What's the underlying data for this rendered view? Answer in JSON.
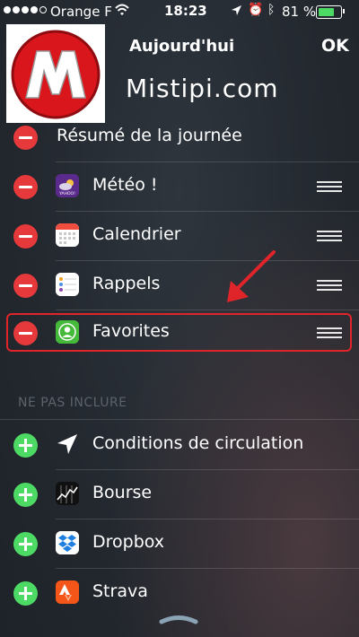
{
  "status_bar": {
    "carrier": "Orange F",
    "time": "18:23",
    "battery_percent": "81 %",
    "battery_level": 0.81,
    "battery_color": "#4cd964"
  },
  "header": {
    "title": "Aujourd'hui",
    "done_label": "OK"
  },
  "watermark": {
    "text": "Mistipi.com",
    "logo_letter": "M"
  },
  "included": {
    "items": [
      {
        "label": "Résumé de la journée",
        "icon": "none"
      },
      {
        "label": "Météo !",
        "icon": "yahoo-weather-icon"
      },
      {
        "label": "Calendrier",
        "icon": "calendar-icon"
      },
      {
        "label": "Rappels",
        "icon": "reminders-icon"
      },
      {
        "label": "Favorites",
        "icon": "favorites-contact-icon",
        "highlighted": true
      }
    ]
  },
  "excluded": {
    "section_title": "NE PAS INCLURE",
    "items": [
      {
        "label": "Conditions de circulation",
        "icon": "location-arrow-icon"
      },
      {
        "label": "Bourse",
        "icon": "stocks-icon"
      },
      {
        "label": "Dropbox",
        "icon": "dropbox-icon"
      },
      {
        "label": "Strava",
        "icon": "strava-icon"
      }
    ]
  },
  "colors": {
    "remove": "#e5393b",
    "add": "#4cd964",
    "highlight": "#e0252a"
  }
}
